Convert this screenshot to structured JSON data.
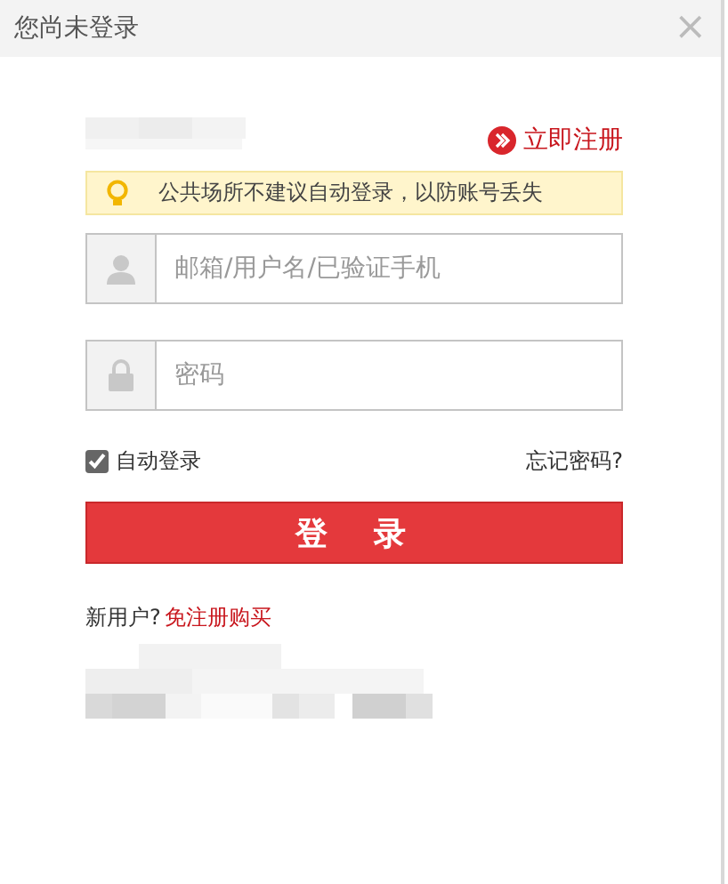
{
  "window": {
    "title": "您尚未登录",
    "close": "×"
  },
  "register_link": "立即注册",
  "tip": "公共场所不建议自动登录，以防账号丢失",
  "fields": [
    {
      "kind": "user",
      "placeholder": "邮箱/用户名/已验证手机"
    },
    {
      "kind": "lock",
      "placeholder": "密码"
    }
  ],
  "auto_login": {
    "label": "自动登录",
    "checked": true
  },
  "forgot_link": "忘记密码?",
  "login_button": "登　录",
  "new_user": {
    "label": "新用户?",
    "link": "免注册购买"
  }
}
